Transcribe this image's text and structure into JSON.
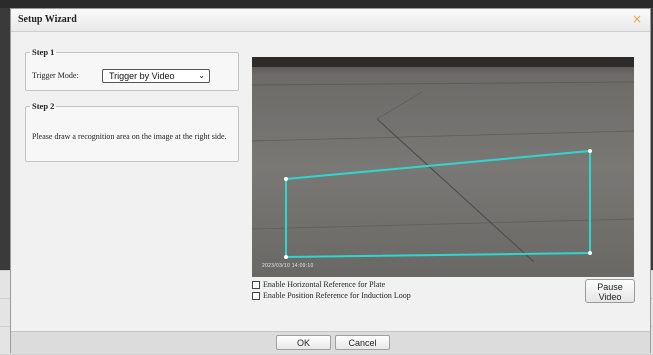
{
  "dialog": {
    "title": "Setup Wizard",
    "close_glyph": "×"
  },
  "step1": {
    "legend": "Step 1",
    "trigger_label": "Trigger Mode:",
    "trigger_value": "Trigger by Video",
    "trigger_chevron": "⌄"
  },
  "step2": {
    "legend": "Step 2",
    "instruction": "Please draw a recognition area on the image at the right side."
  },
  "video": {
    "osd_timestamp": "2023/03/10 14:09:10",
    "region_color": "#2fd6d0"
  },
  "options": {
    "horizontal_reference": "Enable Horizontal Reference for Plate",
    "position_reference": "Enable Position Reference for Induction Loop",
    "pause_label": "Pause Video"
  },
  "footer": {
    "ok": "OK",
    "cancel": "Cancel"
  }
}
